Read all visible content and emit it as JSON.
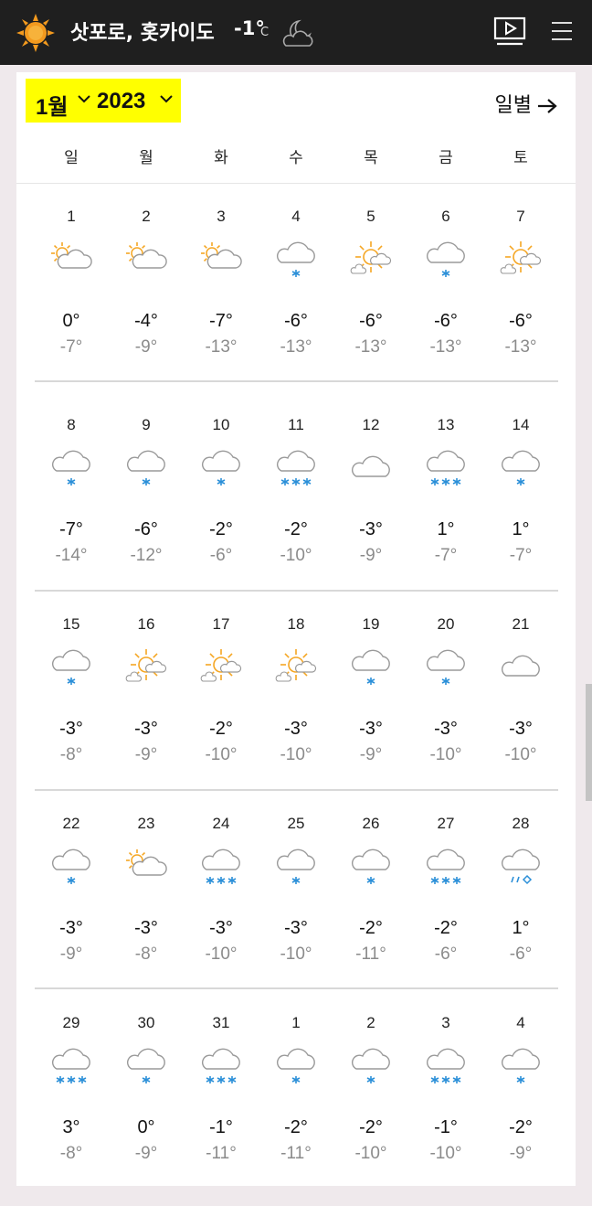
{
  "header": {
    "location": "삿포로, 홋카이도",
    "current_temp": "-1°",
    "unit": "C",
    "weather_icon": "moon-cloud-icon",
    "video_icon": "video-play-icon",
    "menu_icon": "hamburger-menu-icon"
  },
  "toolbar": {
    "month": "1월",
    "year": "2023",
    "daily_label": "일별"
  },
  "weekdays": [
    "일",
    "월",
    "화",
    "수",
    "목",
    "금",
    "토"
  ],
  "colors": {
    "topbar": "#1f1f1f",
    "highlight": "#ffff00",
    "sun": "#f5a623",
    "snow": "#2b8fd8"
  },
  "weeks": [
    [
      {
        "date": "1",
        "icon": "partly-sunny",
        "hi": "0°",
        "lo": "-7°"
      },
      {
        "date": "2",
        "icon": "partly-sunny",
        "hi": "-4°",
        "lo": "-9°"
      },
      {
        "date": "3",
        "icon": "partly-sunny",
        "hi": "-7°",
        "lo": "-13°"
      },
      {
        "date": "4",
        "icon": "snow",
        "hi": "-6°",
        "lo": "-13°"
      },
      {
        "date": "5",
        "icon": "mostly-sunny",
        "hi": "-6°",
        "lo": "-13°"
      },
      {
        "date": "6",
        "icon": "snow",
        "hi": "-6°",
        "lo": "-13°"
      },
      {
        "date": "7",
        "icon": "mostly-sunny",
        "hi": "-6°",
        "lo": "-13°"
      }
    ],
    [
      {
        "date": "8",
        "icon": "snow",
        "hi": "-7°",
        "lo": "-14°"
      },
      {
        "date": "9",
        "icon": "snow",
        "hi": "-6°",
        "lo": "-12°"
      },
      {
        "date": "10",
        "icon": "snow",
        "hi": "-2°",
        "lo": "-6°"
      },
      {
        "date": "11",
        "icon": "heavy-snow",
        "hi": "-2°",
        "lo": "-10°"
      },
      {
        "date": "12",
        "icon": "cloudy",
        "hi": "-3°",
        "lo": "-9°"
      },
      {
        "date": "13",
        "icon": "heavy-snow",
        "hi": "1°",
        "lo": "-7°"
      },
      {
        "date": "14",
        "icon": "snow",
        "hi": "1°",
        "lo": "-7°"
      }
    ],
    [
      {
        "date": "15",
        "icon": "snow",
        "hi": "-3°",
        "lo": "-8°"
      },
      {
        "date": "16",
        "icon": "mostly-sunny",
        "hi": "-3°",
        "lo": "-9°"
      },
      {
        "date": "17",
        "icon": "mostly-sunny",
        "hi": "-2°",
        "lo": "-10°"
      },
      {
        "date": "18",
        "icon": "mostly-sunny",
        "hi": "-3°",
        "lo": "-10°"
      },
      {
        "date": "19",
        "icon": "snow",
        "hi": "-3°",
        "lo": "-9°"
      },
      {
        "date": "20",
        "icon": "snow",
        "hi": "-3°",
        "lo": "-10°"
      },
      {
        "date": "21",
        "icon": "cloudy",
        "hi": "-3°",
        "lo": "-10°"
      }
    ],
    [
      {
        "date": "22",
        "icon": "snow",
        "hi": "-3°",
        "lo": "-9°"
      },
      {
        "date": "23",
        "icon": "partly-sunny",
        "hi": "-3°",
        "lo": "-8°"
      },
      {
        "date": "24",
        "icon": "heavy-snow",
        "hi": "-3°",
        "lo": "-10°"
      },
      {
        "date": "25",
        "icon": "snow",
        "hi": "-3°",
        "lo": "-10°"
      },
      {
        "date": "26",
        "icon": "snow",
        "hi": "-2°",
        "lo": "-11°"
      },
      {
        "date": "27",
        "icon": "heavy-snow",
        "hi": "-2°",
        "lo": "-6°"
      },
      {
        "date": "28",
        "icon": "mixed-rain-snow",
        "hi": "1°",
        "lo": "-6°"
      }
    ],
    [
      {
        "date": "29",
        "icon": "heavy-snow",
        "hi": "3°",
        "lo": "-8°"
      },
      {
        "date": "30",
        "icon": "snow",
        "hi": "0°",
        "lo": "-9°"
      },
      {
        "date": "31",
        "icon": "heavy-snow",
        "hi": "-1°",
        "lo": "-11°"
      },
      {
        "date": "1",
        "icon": "snow",
        "hi": "-2°",
        "lo": "-11°"
      },
      {
        "date": "2",
        "icon": "snow",
        "hi": "-2°",
        "lo": "-10°"
      },
      {
        "date": "3",
        "icon": "heavy-snow",
        "hi": "-1°",
        "lo": "-10°"
      },
      {
        "date": "4",
        "icon": "snow",
        "hi": "-2°",
        "lo": "-9°"
      }
    ]
  ]
}
